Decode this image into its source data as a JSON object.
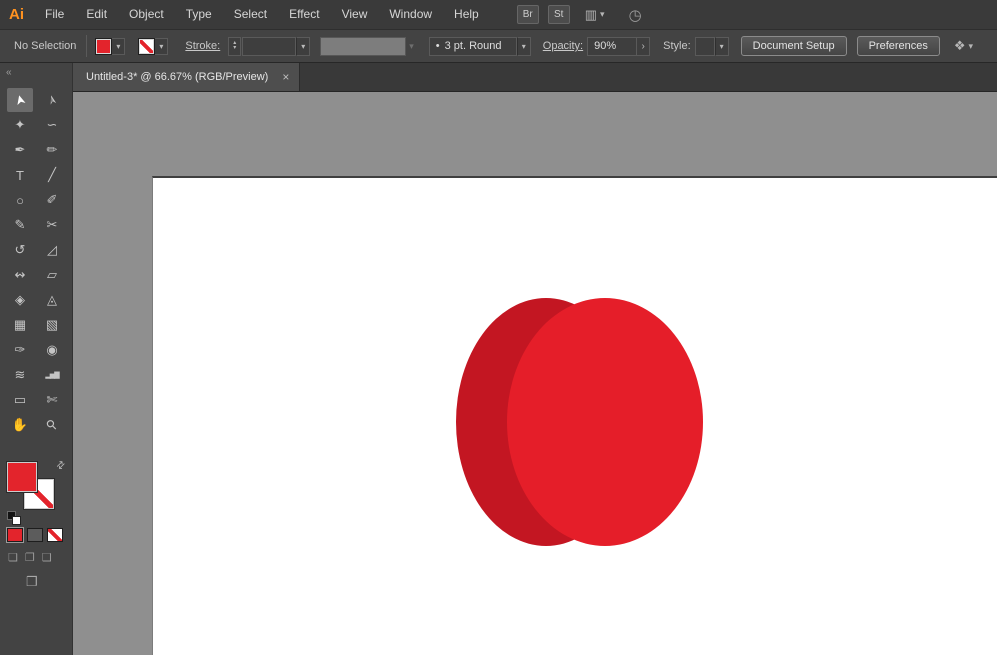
{
  "app": {
    "logo_text": "Ai"
  },
  "menu": {
    "items": [
      "File",
      "Edit",
      "Object",
      "Type",
      "Select",
      "Effect",
      "View",
      "Window",
      "Help"
    ]
  },
  "top_buttons": {
    "br": "Br",
    "st": "St"
  },
  "control_bar": {
    "selection_status": "No Selection",
    "stroke_label": "Stroke:",
    "brush_bullet": "•",
    "brush_name": "3 pt. Round",
    "opacity_label": "Opacity:",
    "opacity_value": "90%",
    "style_label": "Style:",
    "document_setup_label": "Document Setup",
    "preferences_label": "Preferences"
  },
  "tab": {
    "title": "Untitled-3* @ 66.67% (RGB/Preview)",
    "close_glyph": "×"
  },
  "icons": {
    "collapse": "«",
    "caret_down": "▾",
    "stepper_up": "▴",
    "stepper_down": "▾",
    "panel_arrow": "›",
    "swap": "⇄",
    "workspace": "▥",
    "stopwatch": "◷",
    "arrange": "❖",
    "draw_normal": "❏",
    "draw_behind": "❐",
    "draw_inside": "❑",
    "screen_mode": "❒"
  },
  "tool_panel": {
    "tools": [
      {
        "name": "selection-tool",
        "glyph": "➤"
      },
      {
        "name": "direct-selection-tool",
        "glyph": "➢"
      },
      {
        "name": "magic-wand-tool",
        "glyph": "✦"
      },
      {
        "name": "lasso-tool",
        "glyph": "∽"
      },
      {
        "name": "pen-tool",
        "glyph": "✒"
      },
      {
        "name": "curvature-tool",
        "glyph": "✏"
      },
      {
        "name": "type-tool",
        "glyph": "T"
      },
      {
        "name": "line-segment-tool",
        "glyph": "╱"
      },
      {
        "name": "ellipse-tool",
        "glyph": "○"
      },
      {
        "name": "paintbrush-tool",
        "glyph": "✐"
      },
      {
        "name": "pencil-tool",
        "glyph": "✎"
      },
      {
        "name": "scissors-tool",
        "glyph": "✂"
      },
      {
        "name": "rotate-tool",
        "glyph": "↺"
      },
      {
        "name": "scale-tool",
        "glyph": "◿"
      },
      {
        "name": "width-tool",
        "glyph": "↭"
      },
      {
        "name": "free-transform-tool",
        "glyph": "▱"
      },
      {
        "name": "shape-builder-tool",
        "glyph": "◈"
      },
      {
        "name": "perspective-grid-tool",
        "glyph": "◬"
      },
      {
        "name": "mesh-tool",
        "glyph": "▦"
      },
      {
        "name": "gradient-tool",
        "glyph": "▧"
      },
      {
        "name": "eyedropper-tool",
        "glyph": "✑"
      },
      {
        "name": "blend-tool",
        "glyph": "◉"
      },
      {
        "name": "symbol-sprayer-tool",
        "glyph": "≋"
      },
      {
        "name": "column-graph-tool",
        "glyph": "▂▅▇"
      },
      {
        "name": "artboard-tool",
        "glyph": "▭"
      },
      {
        "name": "slice-tool",
        "glyph": "✄"
      },
      {
        "name": "hand-tool",
        "glyph": "✋"
      },
      {
        "name": "zoom-tool",
        "glyph": "⚲"
      }
    ]
  },
  "colors": {
    "fill_red": "#e3242c",
    "apple_bright": "#e51e29",
    "apple_dark": "#c31622"
  },
  "document": {
    "zoom": "66.67%",
    "color_mode": "RGB/Preview",
    "name": "Untitled-3"
  }
}
